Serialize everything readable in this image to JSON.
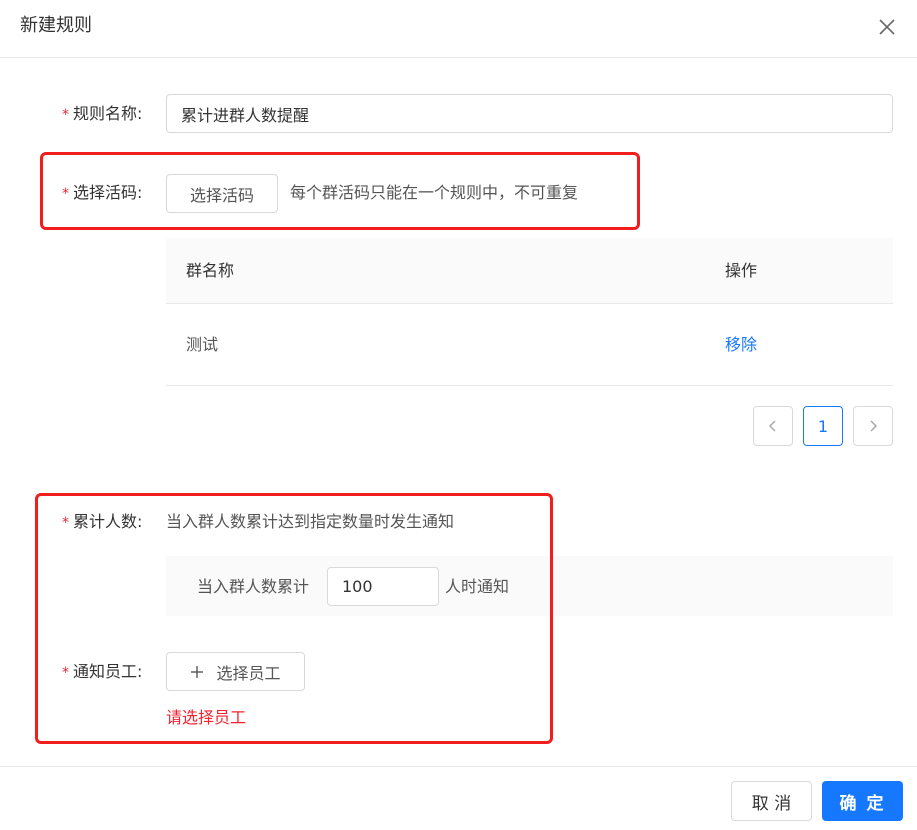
{
  "dialog": {
    "title": "新建规则"
  },
  "form": {
    "required_mark": "*",
    "rule_name": {
      "label": "规则名称:",
      "value": "累计进群人数提醒"
    },
    "select_code": {
      "label": "选择活码:",
      "button_label": "选择活码",
      "hint": "每个群活码只能在一个规则中，不可重复"
    },
    "group_table": {
      "columns": [
        "群名称",
        "操作"
      ],
      "rows": [
        {
          "name": "测试",
          "action": "移除"
        }
      ]
    },
    "pagination": {
      "current_page": "1"
    },
    "cumulative": {
      "label": "累计人数:",
      "description": "当入群人数累计达到指定数量时发生通知",
      "prefix": "当入群人数累计",
      "value": "100",
      "suffix": "人时通知"
    },
    "notify_staff": {
      "label": "通知员工:",
      "button_label": "选择员工",
      "button_icon": "plus-icon",
      "error": "请选择员工"
    }
  },
  "footer": {
    "cancel_label": "取 消",
    "confirm_label": "确 定"
  },
  "colors": {
    "primary": "#1677ff",
    "required": "#f5222d",
    "annotation_box": "#f21d1d"
  }
}
